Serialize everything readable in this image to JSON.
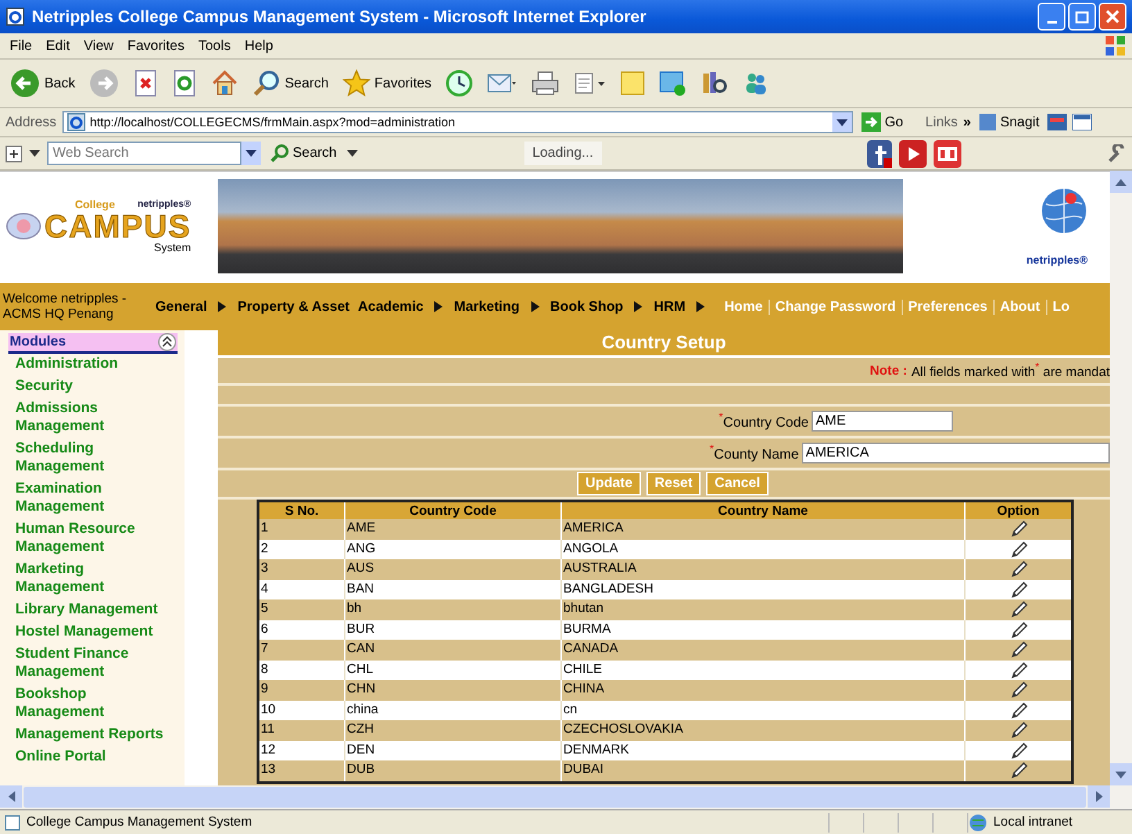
{
  "window": {
    "title": "Netripples College Campus Management System - Microsoft Internet Explorer"
  },
  "menu": [
    "File",
    "Edit",
    "View",
    "Favorites",
    "Tools",
    "Help"
  ],
  "toolbar": [
    {
      "kind": "back",
      "label": "Back"
    },
    {
      "kind": "forward"
    },
    {
      "kind": "stop"
    },
    {
      "kind": "refresh"
    },
    {
      "kind": "home"
    },
    {
      "kind": "search",
      "label": "Search"
    },
    {
      "kind": "favorites",
      "label": "Favorites"
    },
    {
      "kind": "history"
    },
    {
      "kind": "mail"
    },
    {
      "kind": "print"
    },
    {
      "kind": "edit"
    },
    {
      "kind": "note"
    },
    {
      "kind": "messenger"
    },
    {
      "kind": "research"
    },
    {
      "kind": "contacts"
    }
  ],
  "address": {
    "label": "Address",
    "url": "http://localhost/COLLEGECMS/frmMain.aspx?mod=administration",
    "go": "Go",
    "links": "Links",
    "more": "»",
    "snagit": "Snagit"
  },
  "search_bar": {
    "placeholder": "Web Search",
    "button": "Search",
    "status": "Loading..."
  },
  "logo": {
    "top": "College",
    "brand": "netripples®",
    "title": "CAMPUS",
    "subtitle": "System"
  },
  "right_logo": {
    "brand": "netripples®"
  },
  "nav": {
    "welcome": "Welcome netripples - ACMS HQ Penang",
    "items": [
      {
        "label": "General",
        "kind": "menu",
        "submenu": true
      },
      {
        "label": "Property & Asset",
        "kind": "menu",
        "submenu": false
      },
      {
        "label": "Academic",
        "kind": "menu",
        "submenu": true
      },
      {
        "label": "Marketing",
        "kind": "menu",
        "submenu": true
      },
      {
        "label": "Book Shop",
        "kind": "menu",
        "submenu": true
      },
      {
        "label": "HRM",
        "kind": "menu",
        "submenu": true
      },
      {
        "label": "Home",
        "kind": "link"
      },
      {
        "label": "Change Password",
        "kind": "link"
      },
      {
        "label": "Preferences",
        "kind": "link"
      },
      {
        "label": "About",
        "kind": "link"
      },
      {
        "label": "Lo",
        "kind": "link"
      }
    ]
  },
  "sidebar": {
    "title": "Modules",
    "expanded": true,
    "items": [
      "Administration",
      "Security",
      "Admissions Management",
      "Scheduling Management",
      "Examination Management",
      "Human Resource Management",
      "Marketing Management",
      "Library Management",
      "Hostel Management",
      "Student Finance Management",
      "Bookshop Management",
      "Management Reports",
      "Online Portal"
    ]
  },
  "page": {
    "title": "Country Setup",
    "note": {
      "label": "Note :",
      "before": "All fields marked with",
      "mark": "*",
      "after": "are mandat"
    },
    "fields": [
      {
        "mark": "*",
        "label": "Country Code",
        "value": "AME"
      },
      {
        "mark": "*",
        "label": "County Name",
        "value": "AMERICA"
      }
    ],
    "buttons": [
      "Update",
      "Reset",
      "Cancel"
    ]
  },
  "table": {
    "columns": [
      "S No.",
      "Country Code",
      "Country Name",
      "Option"
    ],
    "rows": [
      [
        "1",
        "AME",
        "AMERICA"
      ],
      [
        "2",
        "ANG",
        "ANGOLA"
      ],
      [
        "3",
        "AUS",
        "AUSTRALIA"
      ],
      [
        "4",
        "BAN",
        "BANGLADESH"
      ],
      [
        "5",
        "bh",
        "bhutan"
      ],
      [
        "6",
        "BUR",
        "BURMA"
      ],
      [
        "7",
        "CAN",
        "CANADA"
      ],
      [
        "8",
        "CHL",
        "CHILE"
      ],
      [
        "9",
        "CHN",
        "CHINA"
      ],
      [
        "10",
        "china",
        "cn"
      ],
      [
        "11",
        "CZH",
        "CZECHOSLOVAKIA"
      ],
      [
        "12",
        "DEN",
        "DENMARK"
      ],
      [
        "13",
        "DUB",
        "DUBAI"
      ]
    ]
  },
  "status_bar": {
    "text": "College Campus Management System",
    "zone": "Local intranet"
  }
}
